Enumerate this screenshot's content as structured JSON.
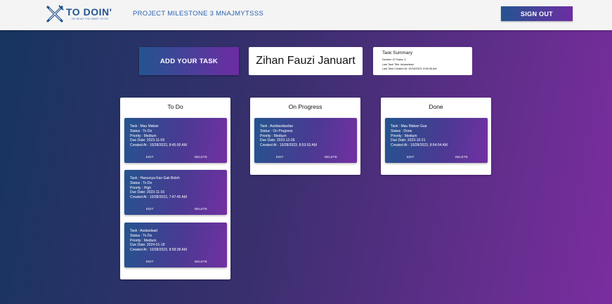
{
  "header": {
    "logo_text": "TO DOIN'",
    "logo_tagline": "DO WHAT YOU WANT TO DO",
    "project_title": "PROJECT MILESTONE 3 MNAJMYTSSS",
    "signout_label": "SIGN OUT"
  },
  "actions": {
    "add_task_label": "ADD YOUR TASK"
  },
  "user": {
    "name": "Zihan Fauzi Januart"
  },
  "summary": {
    "title": "Task Summary",
    "number_of_tasks": "Number Of Tasks: 5",
    "last_task_title": "Last Task Title: Asdasdsad",
    "last_task_created": "Last Task Created At: 10/28/2023, 8:58:38 AM"
  },
  "columns": [
    {
      "title": "To Do",
      "cards": [
        {
          "task": "Task : Mau Makan",
          "status": "Status : To Do",
          "priority": "Priority : Medium",
          "due": "Due Date: 2023-11-09",
          "created": "Created At : 10/28/2023, 8:45:00 AM",
          "edit_label": "EDIT",
          "delete_label": "DELETE"
        },
        {
          "task": "Task : Harusnya Kan Gak Boleh",
          "status": "Status : To Do",
          "priority": "Priority : High",
          "due": "Due Date: 2023-11-16",
          "created": "Created At : 10/28/2023, 7:47:45 AM",
          "edit_label": "EDIT",
          "delete_label": "DELETE"
        },
        {
          "task": "Task : Asdasdsad",
          "status": "Status : To Do",
          "priority": "Priority : Medium",
          "due": "Due Date: 2024-01-18",
          "created": "Created At : 10/28/2023, 8:58:38 AM",
          "edit_label": "EDIT",
          "delete_label": "DELETE"
        }
      ]
    },
    {
      "title": "On Progress",
      "cards": [
        {
          "task": "Task : Asddasdasdas",
          "status": "Status : On Progress",
          "priority": "Priority : Medium",
          "due": "Due Date: 2023-12-06",
          "created": "Created At : 10/28/2023, 8:53:53 AM",
          "edit_label": "EDIT",
          "delete_label": "DELETE"
        }
      ]
    },
    {
      "title": "Done",
      "cards": [
        {
          "task": "Task : Mau Makan Gua",
          "status": "Status : Done",
          "priority": "Priority : Medium",
          "due": "Due Date: 2023-10-21",
          "created": "Created At : 10/28/2023, 8:54:04 AM",
          "edit_label": "EDIT",
          "delete_label": "DELETE"
        }
      ]
    }
  ]
}
